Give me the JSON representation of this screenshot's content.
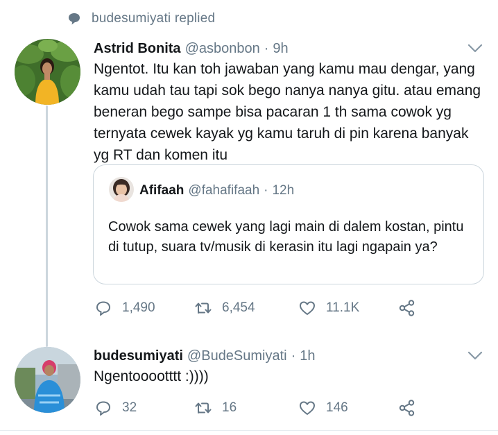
{
  "context": {
    "text": "budesumiyati replied",
    "icon": "speech-bubble-icon"
  },
  "tweet1": {
    "name": "Astrid Bonita",
    "handle": "@asbonbon",
    "separator": "·",
    "time": "9h",
    "text": "Ngentot. Itu kan toh jawaban yang kamu mau dengar, yang kamu udah tau tapi sok bego nanya nanya gitu. atau emang beneran bego sampe bisa pacaran 1 th sama cowok yg ternyata cewek kayak yg kamu taruh di pin karena banyak yg RT dan komen itu",
    "quote": {
      "name": "Afifaah",
      "handle": "@fahafifaah",
      "separator": "·",
      "time": "12h",
      "text": "Cowok sama cewek yang lagi main di dalem kostan, pintu di tutup, suara tv/musik di kerasin itu lagi ngapain ya?"
    },
    "replies": "1,490",
    "retweets": "6,454",
    "likes": "11.1K"
  },
  "tweet2": {
    "name": "budesumiyati",
    "handle": "@BudeSumiyati",
    "separator": "·",
    "time": "1h",
    "text": "Ngentooootttt :))))",
    "replies": "32",
    "retweets": "16",
    "likes": "146"
  },
  "colors": {
    "text": "#14171a",
    "secondary": "#657786",
    "border": "#ccd6dd",
    "thread": "#ccd6dd"
  }
}
